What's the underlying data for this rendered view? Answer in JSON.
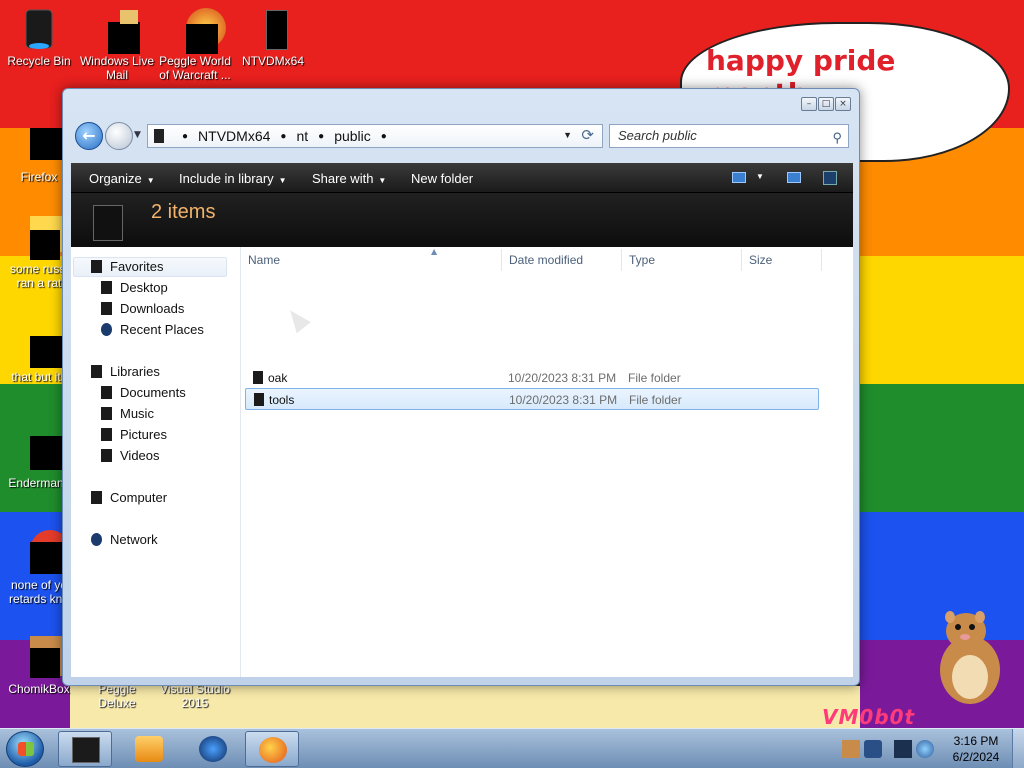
{
  "wallpaper": {
    "stripes": [
      "#e8201e",
      "#ff8c00",
      "#ffd700",
      "#1f8d2c",
      "#1c52ef",
      "#7a1a9a"
    ],
    "bubble_text": "happy pride month",
    "watermark": "VM0b0t"
  },
  "desktop_icons": [
    {
      "label": "Recycle Bin",
      "icon": "recycle-bin-icon"
    },
    {
      "label": "Windows Live Mail",
      "icon": "windows-live-mail-icon"
    },
    {
      "label": "Peggle World of Warcraft ...",
      "icon": "peggle-wow-icon"
    },
    {
      "label": "NTVDMx64",
      "icon": "ntvdmx64-folder-icon"
    },
    {
      "label": "Firefox",
      "icon": "firefox-icon"
    },
    {
      "label": "some russi ran a rat",
      "icon": "russian-shortcut-icon"
    },
    {
      "label": "that but its",
      "icon": "that-but-its-icon"
    },
    {
      "label": "Endermanc",
      "icon": "endermanch-icon"
    },
    {
      "label": "none of yo retards kno",
      "icon": "opera-icon"
    },
    {
      "label": "ChomikBox",
      "icon": "chomikbox-icon"
    },
    {
      "label": "Peggle Deluxe",
      "icon": "peggle-deluxe-icon"
    },
    {
      "label": "Visual Studio 2015",
      "icon": "visual-studio-icon"
    }
  ],
  "window": {
    "address": {
      "crumbs": [
        "NTVDMx64",
        "nt",
        "public"
      ]
    },
    "search": {
      "placeholder": "Search public"
    },
    "toolbar": {
      "organize": "Organize",
      "include_in_library": "Include in library",
      "share_with": "Share with",
      "new_folder": "New folder",
      "item_count": "2 items"
    },
    "nav": {
      "favorites": "Favorites",
      "desktop": "Desktop",
      "downloads": "Downloads",
      "recent_places": "Recent Places",
      "libraries": "Libraries",
      "documents": "Documents",
      "music": "Music",
      "pictures": "Pictures",
      "videos": "Videos",
      "computer": "Computer",
      "network": "Network"
    },
    "columns": {
      "name": "Name",
      "date": "Date modified",
      "type": "Type",
      "size": "Size"
    },
    "files": [
      {
        "name": "oak",
        "date": "10/20/2023 8:31 PM",
        "type": "File folder",
        "selected": false
      },
      {
        "name": "tools",
        "date": "10/20/2023 8:31 PM",
        "type": "File folder",
        "selected": true
      }
    ]
  },
  "taskbar": {
    "clock_time": "3:16 PM",
    "clock_date": "6/2/2024"
  }
}
